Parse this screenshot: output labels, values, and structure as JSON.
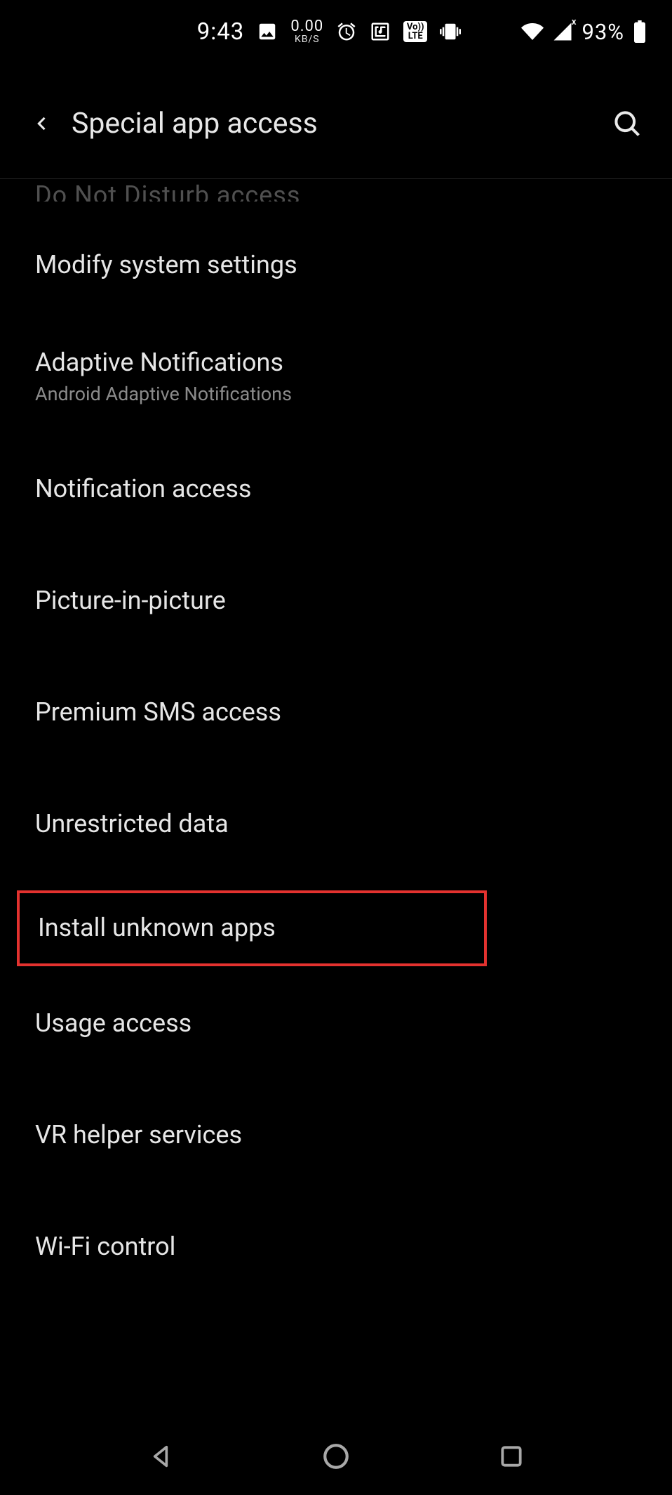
{
  "statusbar": {
    "time": "9:43",
    "network_speed": {
      "value": "0.00",
      "unit": "KB/S"
    },
    "battery_percent": "93%"
  },
  "header": {
    "title": "Special app access"
  },
  "list": {
    "truncated_top": "Do Not Disturb access",
    "items": [
      {
        "title": "Modify system settings"
      },
      {
        "title": "Adaptive Notifications",
        "subtitle": "Android Adaptive Notifications"
      },
      {
        "title": "Notification access"
      },
      {
        "title": "Picture-in-picture"
      },
      {
        "title": "Premium SMS access"
      },
      {
        "title": "Unrestricted data"
      },
      {
        "title": "Install unknown apps",
        "highlighted": true
      },
      {
        "title": "Usage access"
      },
      {
        "title": "VR helper services"
      },
      {
        "title": "Wi-Fi control"
      }
    ]
  },
  "icons": {
    "volte_top": "Vo))",
    "volte_bot": "LTE"
  }
}
